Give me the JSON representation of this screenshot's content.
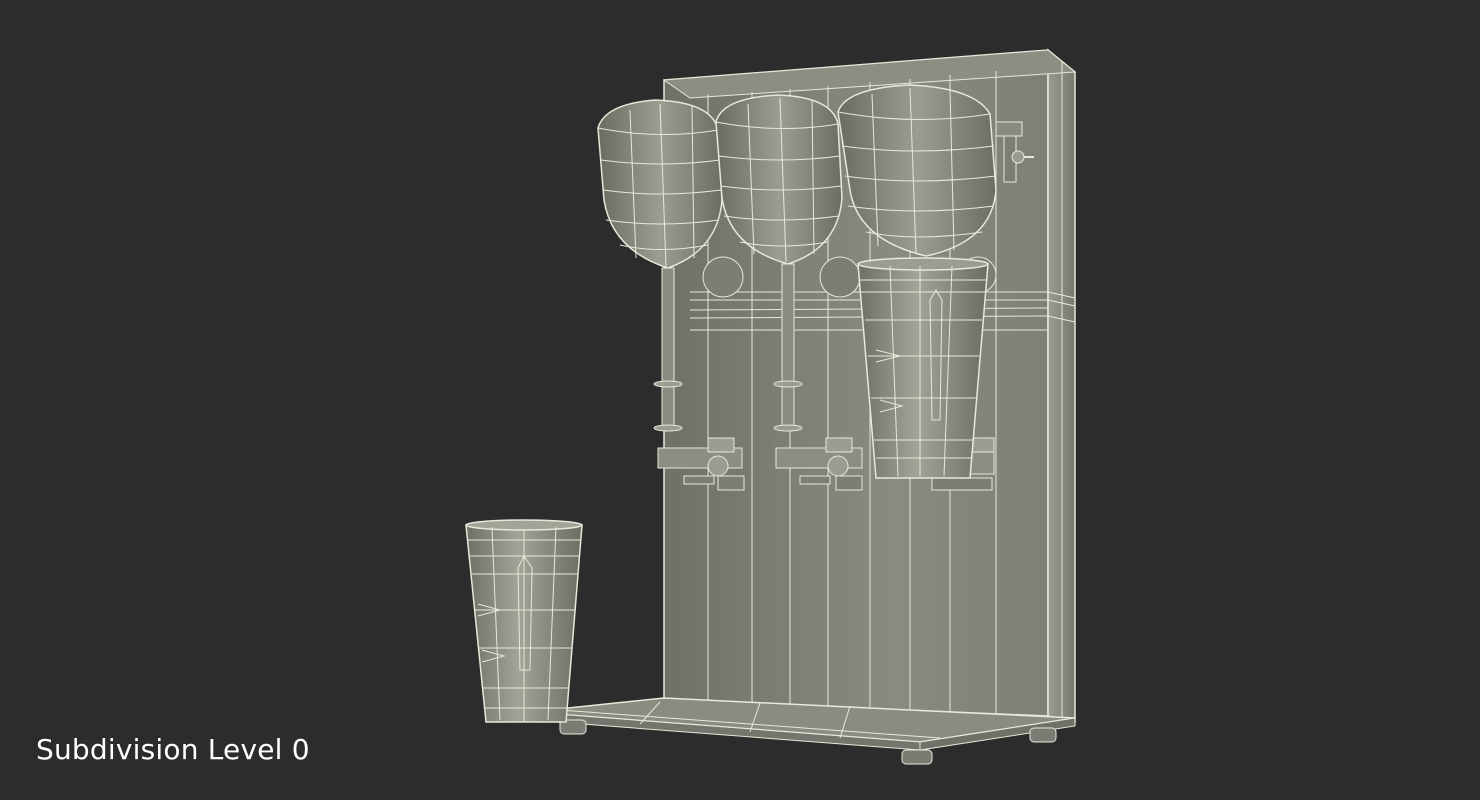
{
  "caption": {
    "text": "Subdivision Level 0"
  },
  "scene": {
    "background_color": "#2b2c2c",
    "model_color": "#83847a",
    "wire_color": "#e9e7d8"
  }
}
